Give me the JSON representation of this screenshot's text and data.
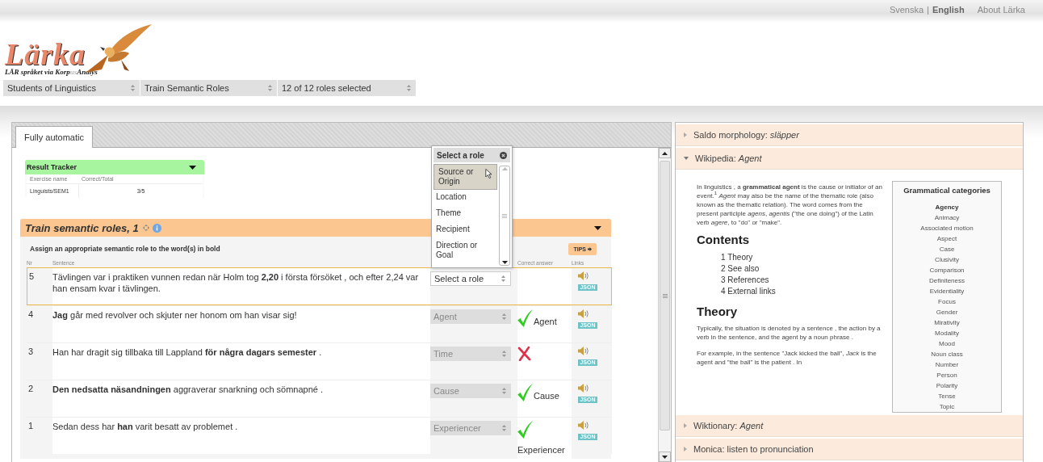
{
  "top_links": {
    "languages": [
      {
        "label": "Svenska",
        "selected": false
      },
      {
        "label": "English",
        "selected": true
      }
    ],
    "separator": "|",
    "about": "About Lärka"
  },
  "logo": {
    "name": "Lärka",
    "tagline_start": "LÄR språket via Korp",
    "tagline_faint": "us",
    "tagline_end": "Analys"
  },
  "nav": [
    "Students of Linguistics",
    "Train Semantic Roles",
    "12 of 12 roles selected"
  ],
  "tabs": [
    {
      "label": "Fully automatic",
      "selected": true
    }
  ],
  "result_tracker": {
    "title": "Result Tracker",
    "columns": [
      "Exercise name",
      "Correct/Total"
    ],
    "rows": [
      [
        "Linguists/SEM1",
        "3/5"
      ]
    ]
  },
  "exercise": {
    "title": "Train semantic roles, 1",
    "instruction": "Assign an appropriate semantic role to the word(s) in bold",
    "tips": "TIPS",
    "columns": [
      "Nr",
      "Sentence",
      "Correct answer",
      "Links"
    ],
    "rows": [
      {
        "nr": "5",
        "sentence": "Tävlingen var i praktiken vunnen redan när Holm tog **2,20** i första försöket , och efter 2,24 var han ensam kvar i tävlingen.",
        "answer": "Select a role",
        "disabled": false,
        "selected": true,
        "kind": "pending",
        "json": "JSON"
      },
      {
        "nr": "4",
        "sentence": "**Jag** går med revolver och skjuter ner honom om han visar sig!",
        "answer": "Agent",
        "disabled": true,
        "selected": false,
        "kind": "correct",
        "correct_answer": "Agent",
        "json": "JSON"
      },
      {
        "nr": "3",
        "sentence": "Han har dragit sig tillbaka till Lappland **för några dagars semester** .",
        "answer": "Time",
        "disabled": true,
        "selected": false,
        "kind": "wrong",
        "json": "JSON"
      },
      {
        "nr": "2",
        "sentence": "**Den nedsatta näsandningen** aggraverar snarkning och sömnapné .",
        "answer": "Cause",
        "disabled": true,
        "selected": false,
        "kind": "correct",
        "correct_answer": "Cause",
        "json": "JSON"
      },
      {
        "nr": "1",
        "sentence": "Sedan dess har **han** varit besatt av problemet .",
        "answer": "Experiencer",
        "disabled": true,
        "selected": false,
        "kind": "correct",
        "correct_answer": "Experiencer",
        "json": "JSON"
      }
    ]
  },
  "role_menu": {
    "title": "Select a role",
    "options": [
      {
        "label": "Source or Origin",
        "selected": true
      },
      {
        "label": "Location",
        "selected": false
      },
      {
        "label": "Theme",
        "selected": false
      },
      {
        "label": "Recipient",
        "selected": false
      },
      {
        "label": "Direction or Goal",
        "selected": false
      }
    ]
  },
  "sidebar": [
    {
      "title": "Saldo morphology: *släpper*",
      "expanded": false
    },
    {
      "title": "Wikipedia: *Agent*",
      "expanded": true,
      "content": {
        "intro": "In linguistics , a **grammatical agent** is the cause or initiator of an event.$^{1}$ *Agent* may also be the name of the thematic role (also known as the thematic relation). The word comes from the present participle *agens*, *agentis* (\"the one doing\") of the Latin verb *agere*, to \"do\" or \"make\".",
        "contents_heading": "Contents",
        "contents": [
          "1 Theory",
          "2 See also",
          "3 References",
          "4 External links"
        ],
        "section_heading": "Theory",
        "paragraphs": [
          "Typically, the situation is denoted by a sentence , the action by a verb in the sentence, and the agent by a noun phrase .",
          "For example, in the sentence \"Jack kicked the ball\", *Jack* is the agent and \"the ball\" is the patient . In"
        ],
        "infobox": {
          "title": "Grammatical categories",
          "items": [
            {
              "label": "Agency",
              "selected": true
            },
            {
              "label": "Animacy",
              "selected": false
            },
            {
              "label": "Associated motion",
              "selected": false
            },
            {
              "label": "Aspect",
              "selected": false
            },
            {
              "label": "Case",
              "selected": false
            },
            {
              "label": "Clusivity",
              "selected": false
            },
            {
              "label": "Comparison",
              "selected": false
            },
            {
              "label": "Definiteness",
              "selected": false
            },
            {
              "label": "Evidentiality",
              "selected": false
            },
            {
              "label": "Focus",
              "selected": false
            },
            {
              "label": "Gender",
              "selected": false
            },
            {
              "label": "Mirativity",
              "selected": false
            },
            {
              "label": "Modality",
              "selected": false
            },
            {
              "label": "Mood",
              "selected": false
            },
            {
              "label": "Noun class",
              "selected": false
            },
            {
              "label": "Number",
              "selected": false
            },
            {
              "label": "Person",
              "selected": false
            },
            {
              "label": "Polarity",
              "selected": false
            },
            {
              "label": "Tense",
              "selected": false
            },
            {
              "label": "Topic",
              "selected": false
            }
          ]
        }
      }
    },
    {
      "title": "Wiktionary: *Agent*",
      "expanded": false
    },
    {
      "title": "Monica: listen to pronunciation",
      "expanded": false
    }
  ]
}
